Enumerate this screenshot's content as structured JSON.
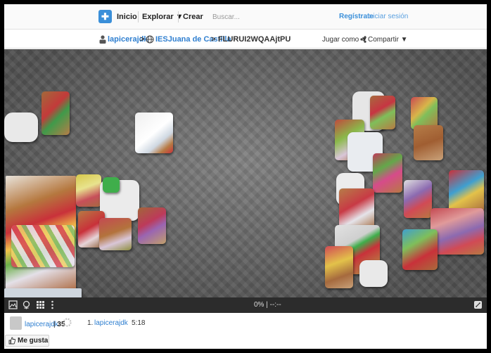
{
  "nav": {
    "home": "Inicio",
    "explore": "Explorar ▼",
    "create": "Crear",
    "search_placeholder": "Buscar...",
    "register": "Regístrate",
    "login": "Iniciar sesión"
  },
  "breadcrumb": {
    "user": "lapicerajdk",
    "sep1": ">",
    "group": "IESJuana de Castilla",
    "sep2": ">",
    "puzzle": "FLURUI2WQAAjtPU"
  },
  "actions": {
    "play_as": "Jugar como ▼",
    "share": "Compartir ▼"
  },
  "toolbar": {
    "progress": "0%  |  --:--"
  },
  "footer": {
    "user": "lapicerajdk",
    "separator": "|",
    "score": "35",
    "rank": "1.",
    "rank_user": "lapicerajdk",
    "time": "5:18",
    "like": "Me gusta"
  },
  "colors": {
    "accent": "#3a8fd9",
    "toolbar": "#2c2c2c",
    "board": "#6e6e6e"
  }
}
